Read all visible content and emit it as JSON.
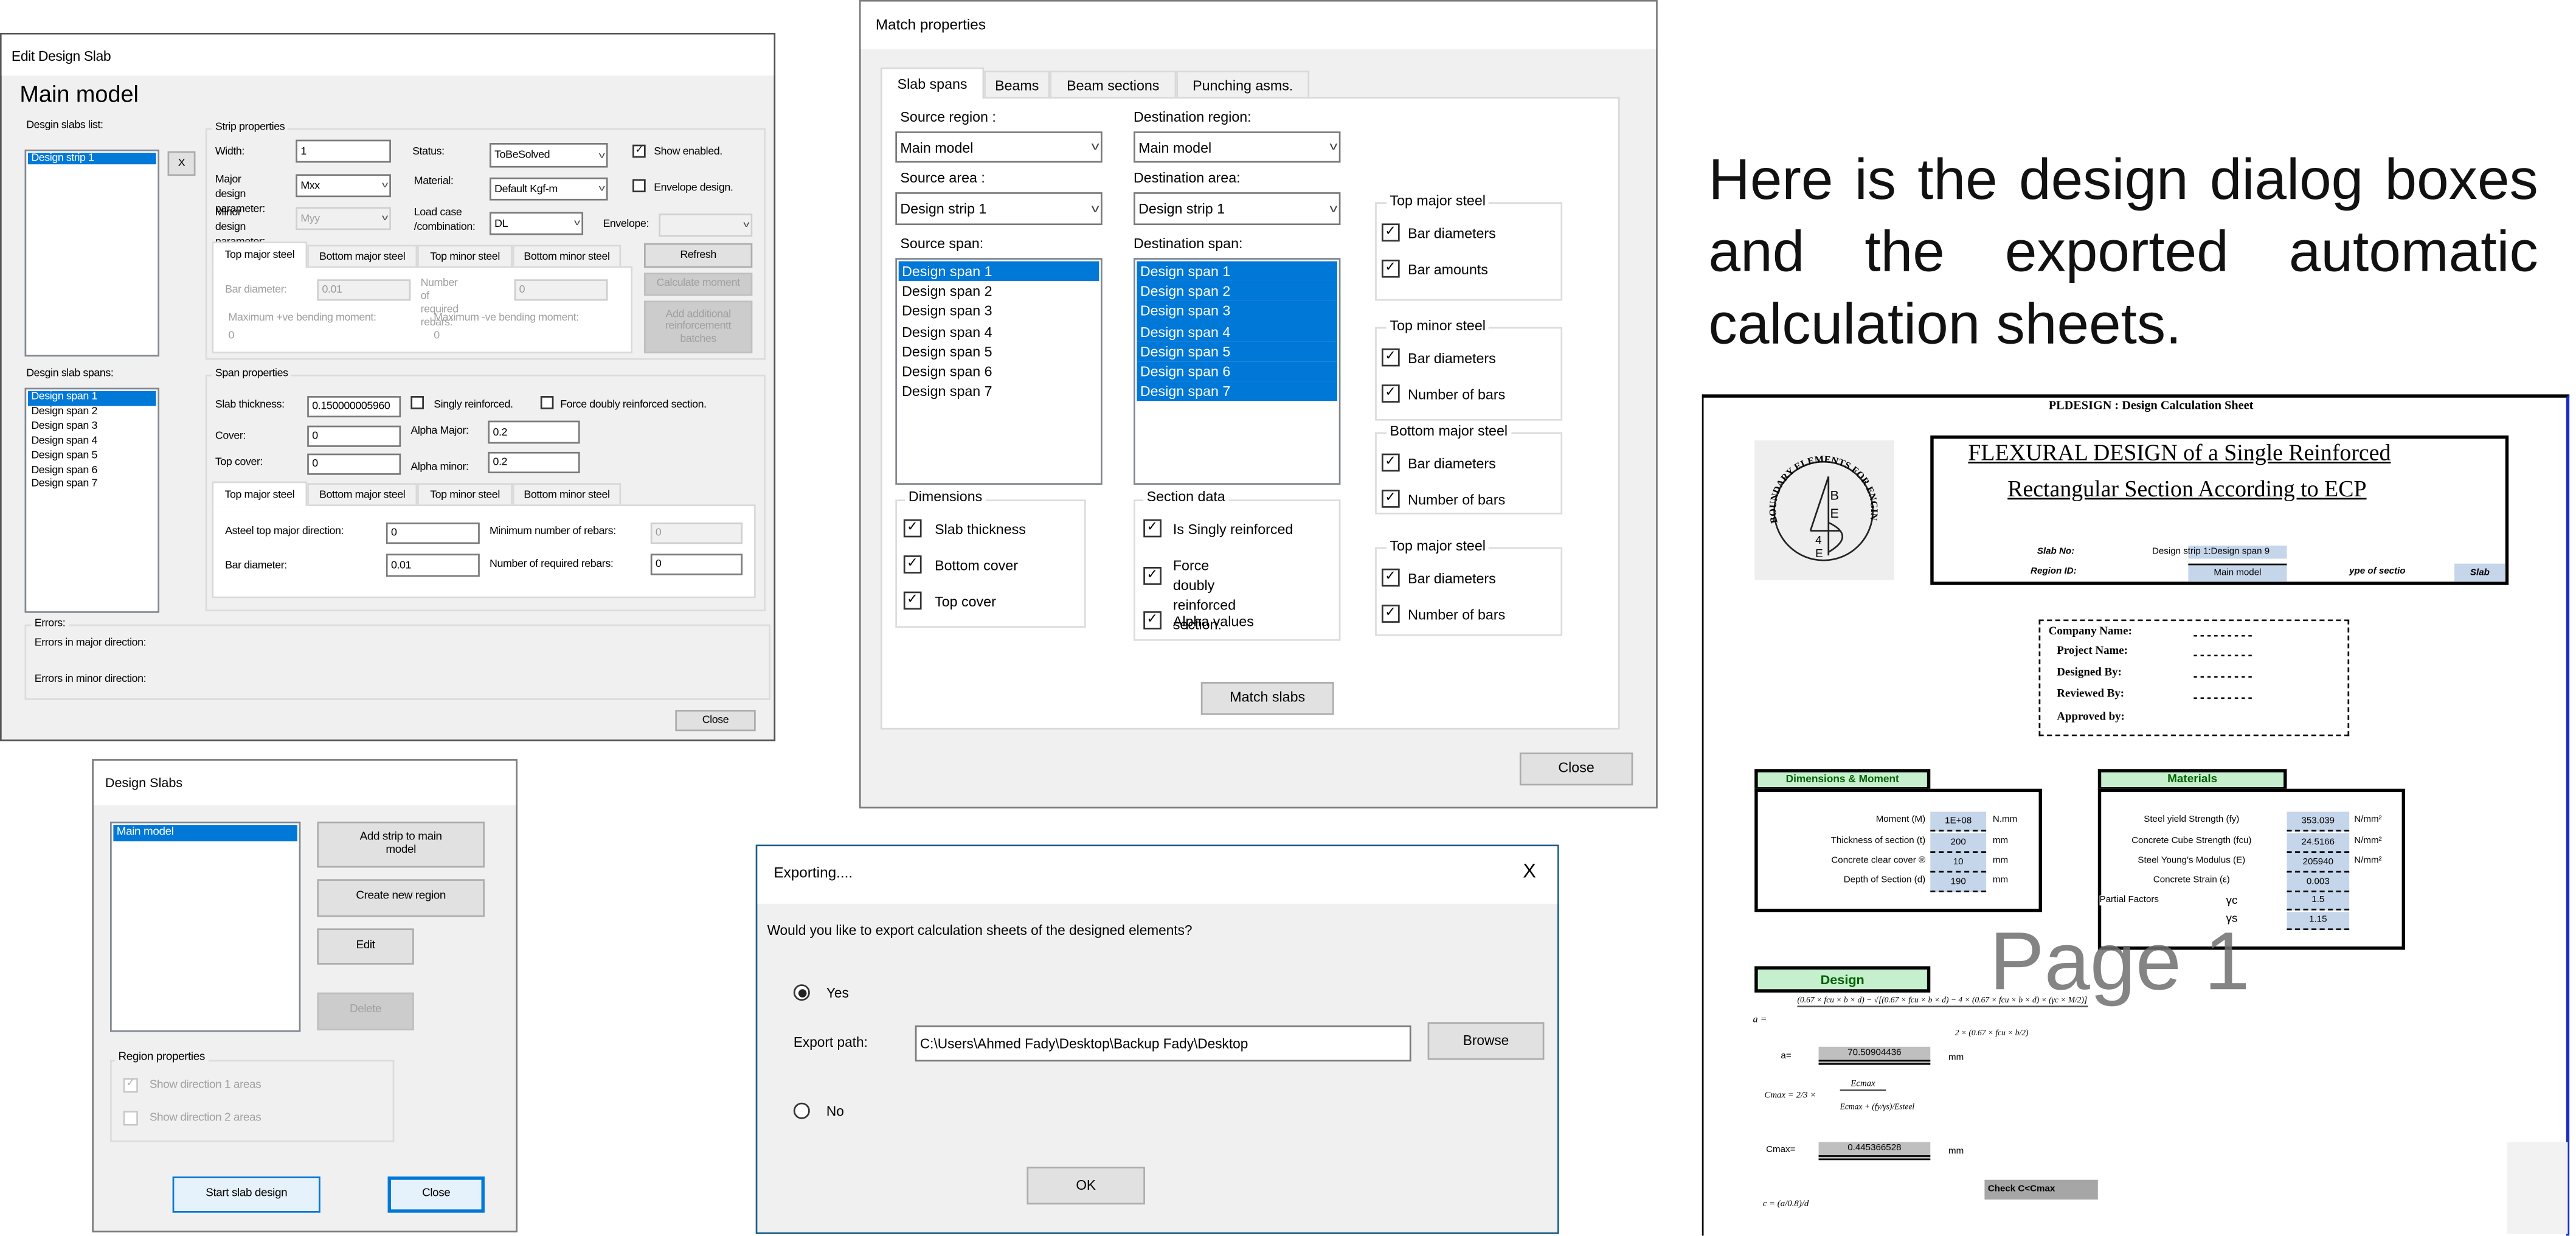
{
  "edit_dialog": {
    "title": "Edit Design Slab",
    "heading": "Main model",
    "slabs_list_label": "Desgin slabs list:",
    "slabs": [
      "Design strip 1"
    ],
    "remove_label": "X",
    "strip_group": "Strip properties",
    "width_label": "Width:",
    "width_value": "1",
    "status_label": "Status:",
    "status_value": "ToBeSolved",
    "show_enabled": {
      "label": "Show enabled.",
      "checked": true
    },
    "major_label": "Major design\nparameter:",
    "major_value": "Mxx",
    "material_label": "Material:",
    "material_value": "Default Kgf-m",
    "envelope_design": {
      "label": "Envelope design.",
      "checked": false
    },
    "minor_label": "Minor design\nparameter:",
    "minor_value": "Myy",
    "loadcase_label": "Load case\n/combination:",
    "loadcase_value": "DL",
    "envelope_label": "Envelope:",
    "envelope_value": "",
    "tabs": [
      "Top major steel",
      "Bottom major steel",
      "Top minor steel",
      "Bottom minor steel"
    ],
    "bar_diameter_label": "Bar diameter:",
    "bar_diameter_value": "0.01",
    "num_rebars_label": "Number of\nrequired rebars:",
    "num_rebars_value": "0",
    "max_pos_label": "Maximum +ve bending moment:",
    "max_pos_value": "0",
    "max_neg_label": "Maximum -ve bending moment:",
    "max_neg_value": "0",
    "refresh": "Refresh",
    "calc_moment": "Calculate moment",
    "add_batches": "Add additional\nreinforcementt\nbatches",
    "spans_label": "Desgin slab spans:",
    "spans": [
      "Design span 1",
      "Design span 2",
      "Design span 3",
      "Design span 4",
      "Design span 5",
      "Design span 6",
      "Design span 7"
    ],
    "span_group": "Span properties",
    "slab_thickness_label": "Slab thickness:",
    "slab_thickness_value": "0.150000005960",
    "singly": {
      "label": "Singly reinforced.",
      "checked": false
    },
    "force_doubly": {
      "label": "Force doubly reinforced section.",
      "checked": false
    },
    "cover_label": "Cover:",
    "cover_value": "0",
    "top_cover_label": "Top cover:",
    "top_cover_value": "0",
    "alpha_major_label": "Alpha Major:",
    "alpha_major_value": "0.2",
    "alpha_minor_label": "Alpha minor:",
    "alpha_minor_value": "0.2",
    "asteel_label": "Asteel top major direction:",
    "asteel_value": "0",
    "min_rebars_label": "Minimum number of rebars:",
    "min_rebars_value": "0",
    "span_bar_diameter_label": "Bar diameter:",
    "span_bar_diameter_value": "0.01",
    "span_num_rebars_label": "Number of required rebars:",
    "span_num_rebars_value": "0",
    "errors_label": "Errors:",
    "errors_major": "Errors in major direction:",
    "errors_minor": "Errors in minor direction:",
    "close": "Close"
  },
  "match_dialog": {
    "title": "Match properties",
    "tabs": [
      "Slab spans",
      "Beams",
      "Beam sections",
      "Punching asms."
    ],
    "source_region_label": "Source region :",
    "source_region_value": "Main model",
    "dest_region_label": "Destination region:",
    "dest_region_value": "Main model",
    "source_area_label": "Source area :",
    "source_area_value": "Design strip 1",
    "dest_area_label": "Destination area:",
    "dest_area_value": "Design strip 1",
    "source_span_label": "Source span:",
    "dest_span_label": "Destination span:",
    "spans": [
      "Design span 1",
      "Design span 2",
      "Design span 3",
      "Design span 4",
      "Design span 5",
      "Design span 6",
      "Design span 7"
    ],
    "dimensions": {
      "label": "Dimensions",
      "items": [
        {
          "label": "Slab thickness",
          "checked": true
        },
        {
          "label": "Bottom cover",
          "checked": true
        },
        {
          "label": "Top cover",
          "checked": true
        }
      ]
    },
    "section_data": {
      "label": "Section data",
      "items": [
        {
          "label": "Is Singly reinforced",
          "checked": true
        },
        {
          "label": "Force doubly\nreinforced section.",
          "checked": true
        },
        {
          "label": "Alpha values",
          "checked": true
        }
      ]
    },
    "steel_groups": [
      {
        "label": "Top major steel",
        "items": [
          {
            "label": "Bar diameters",
            "checked": true
          },
          {
            "label": "Bar amounts",
            "checked": true
          }
        ]
      },
      {
        "label": "Top minor steel",
        "items": [
          {
            "label": "Bar diameters",
            "checked": true
          },
          {
            "label": "Number of bars",
            "checked": true
          }
        ]
      },
      {
        "label": "Bottom major steel",
        "items": [
          {
            "label": "Bar diameters",
            "checked": true
          },
          {
            "label": "Number of bars",
            "checked": true
          }
        ]
      },
      {
        "label": "Top major steel",
        "items": [
          {
            "label": "Bar diameters",
            "checked": true
          },
          {
            "label": "Number of bars",
            "checked": true
          }
        ]
      }
    ],
    "match_button": "Match slabs",
    "close": "Close"
  },
  "design_slabs": {
    "title": "Design Slabs",
    "regions": [
      "Main model"
    ],
    "add_strip": "Add strip to main\nmodel",
    "create_region": "Create new region",
    "edit": "Edit",
    "delete": "Delete",
    "region_group": "Region properties",
    "dir1": {
      "label": "Show direction 1 areas",
      "checked": true
    },
    "dir2": {
      "label": "Show direction 2 areas",
      "checked": false
    },
    "start": "Start slab design",
    "close": "Close"
  },
  "export_dialog": {
    "title": "Exporting....",
    "close_glyph": "X",
    "question": "Would you like to export calculation sheets of the designed elements?",
    "yes": "Yes",
    "yes_selected": true,
    "no": "No",
    "path_label": "Export path:",
    "path_value": "C:\\Users\\Ahmed Fady\\Desktop\\Backup Fady\\Desktop",
    "browse": "Browse",
    "ok": "OK"
  },
  "caption": "Here is the design dialog boxes and the exported automatic calculation sheets.",
  "calc_sheet": {
    "header": "PLDESIGN : Design Calculation Sheet",
    "logo_text": "BOUNDARY ELEMENTS FOR ENGINEERS",
    "title_line1": "FLEXURAL DESIGN of a Single Reinforced",
    "title_line2": "Rectangular Section According to ECP",
    "slab_no_label": "Slab No:",
    "slab_no_value": "Design strip 1:Design span 9",
    "region_label": "Region ID:",
    "region_value": "Main model",
    "section_type_label": "ype of sectio",
    "section_type_value": "Slab",
    "info_fields": [
      "Company Name:",
      "Project Name:",
      "Designed By:",
      "Reviewed By:",
      "Approved by:"
    ],
    "info_blank": "---------",
    "dims_header": "Dimensions & Moment",
    "dims": [
      {
        "label": "Moment (M)",
        "value": "1E+08",
        "unit": "N.mm"
      },
      {
        "label": "Thickness of section (t)",
        "value": "200",
        "unit": "mm"
      },
      {
        "label": "Concrete clear cover ®",
        "value": "10",
        "unit": "mm"
      },
      {
        "label": "Depth of Section (d)",
        "value": "190",
        "unit": "mm"
      }
    ],
    "materials_header": "Materials",
    "materials": [
      {
        "label": "Steel yield Strength (fy)",
        "value": "353.039",
        "unit": "N/mm²"
      },
      {
        "label": "Concrete Cube Strength (fcu)",
        "value": "24.5166",
        "unit": "N/mm²"
      },
      {
        "label": "Steel Young's Modulus (E)",
        "value": "205940",
        "unit": "N/mm²"
      },
      {
        "label": "Concrete Strain (ε)",
        "value": "0.003",
        "unit": ""
      }
    ],
    "partial_label": "Partial Factors",
    "gamma_c_label": "γc",
    "gamma_c": "1.5",
    "gamma_s_label": "γs",
    "gamma_s": "1.15",
    "watermark": "Page 1",
    "design_header": "Design",
    "formula_a_num": "(0.67 × fcu × b × d) − √[(0.67 × fcu × b × d) − 4 × (0.67 × fcu × b × d) × (γc × M/2)]",
    "formula_a_lhs": "a =",
    "formula_a_den": "2 × (0.67 × fcu × b/2)",
    "a_label": "a=",
    "a_value": "70.50904436",
    "a_unit": "mm",
    "formula_cmax_lhs": "Cmax = 2/3 ×",
    "formula_cmax_num": "Ecmax",
    "formula_cmax_den": "Ecmax + (fy/γs)/Esteel",
    "cmax_label": "Cmax=",
    "cmax_value": "0.445366528",
    "cmax_unit": "mm",
    "check_label": "Check C<Cmax",
    "formula_c": "c = (a/0.8)/d"
  }
}
